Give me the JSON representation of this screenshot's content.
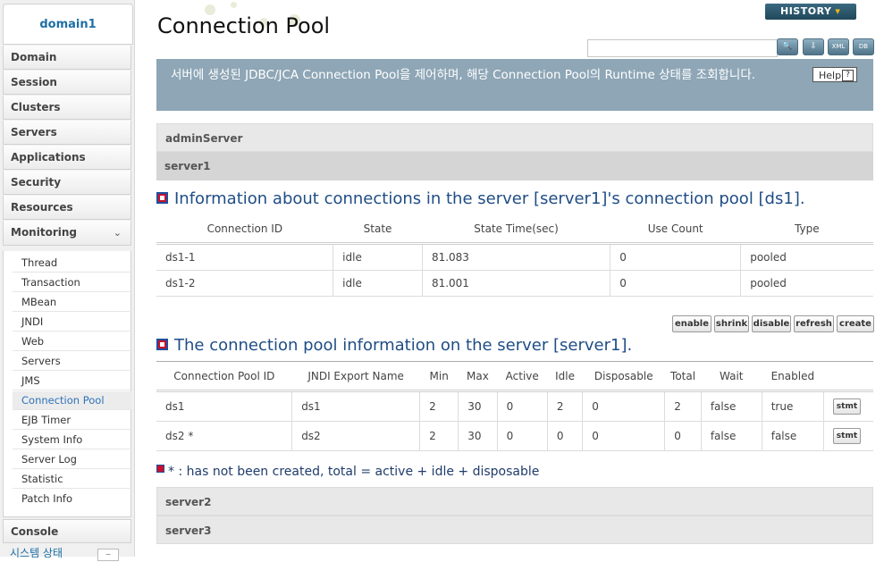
{
  "sidebar": {
    "domain": "domain1",
    "items": [
      {
        "label": "Domain"
      },
      {
        "label": "Session"
      },
      {
        "label": "Clusters"
      },
      {
        "label": "Servers"
      },
      {
        "label": "Applications"
      },
      {
        "label": "Security"
      },
      {
        "label": "Resources"
      },
      {
        "label": "Monitoring"
      }
    ],
    "monitoring_items": [
      {
        "label": "Thread"
      },
      {
        "label": "Transaction"
      },
      {
        "label": "MBean"
      },
      {
        "label": "JNDI"
      },
      {
        "label": "Web"
      },
      {
        "label": "Servers"
      },
      {
        "label": "JMS"
      },
      {
        "label": "Connection Pool"
      },
      {
        "label": "EJB Timer"
      },
      {
        "label": "System Info"
      },
      {
        "label": "Server Log"
      },
      {
        "label": "Statistic"
      },
      {
        "label": "Patch Info"
      }
    ],
    "console": "Console",
    "system_status": "시스템 상태"
  },
  "header": {
    "title": "Connection Pool",
    "history_label": "HISTORY",
    "search_value": "",
    "tools": [
      "search-icon",
      "export-icon",
      "xml-icon",
      "db-icon"
    ],
    "tool_glyphs": [
      "🔍",
      "⇩",
      "XML",
      "DB"
    ]
  },
  "banner": {
    "text": "서버에 생성된 JDBC/JCA Connection Pool을 제어하며, 해당 Connection Pool의 Runtime 상태를 조회합니다.",
    "help_label": "Help",
    "help_glyph": "?"
  },
  "servers_top": [
    "adminServer",
    "server1"
  ],
  "connections": {
    "title": "Information about connections in the server [server1]'s connection pool [ds1].",
    "headers": [
      "Connection ID",
      "State",
      "State Time(sec)",
      "Use Count",
      "Type"
    ],
    "rows": [
      [
        "ds1-1",
        "idle",
        "81.083",
        "0",
        "pooled"
      ],
      [
        "ds1-2",
        "idle",
        "81.001",
        "0",
        "pooled"
      ]
    ]
  },
  "actions": [
    "enable",
    "shrink",
    "disable",
    "refresh",
    "create"
  ],
  "pools": {
    "title": "The connection pool information on the server [server1].",
    "headers": [
      "Connection Pool ID",
      "JNDI Export Name",
      "Min",
      "Max",
      "Active",
      "Idle",
      "Disposable",
      "Total",
      "Wait",
      "Enabled",
      ""
    ],
    "rows": [
      [
        "ds1",
        "ds1",
        "2",
        "30",
        "0",
        "2",
        "0",
        "2",
        "false",
        "true",
        "stmt"
      ],
      [
        "ds2 *",
        "ds2",
        "2",
        "30",
        "0",
        "0",
        "0",
        "0",
        "false",
        "false",
        "stmt"
      ]
    ]
  },
  "note": {
    "star": "*",
    "text": ": has not been created, total = active + idle + disposable"
  },
  "servers_bottom": [
    "server2",
    "server3"
  ],
  "colors": {
    "banner": "#8ea6b6",
    "link": "#1d6fa5",
    "section_title": "#1f4d85",
    "accent_red": "#c8102e"
  }
}
